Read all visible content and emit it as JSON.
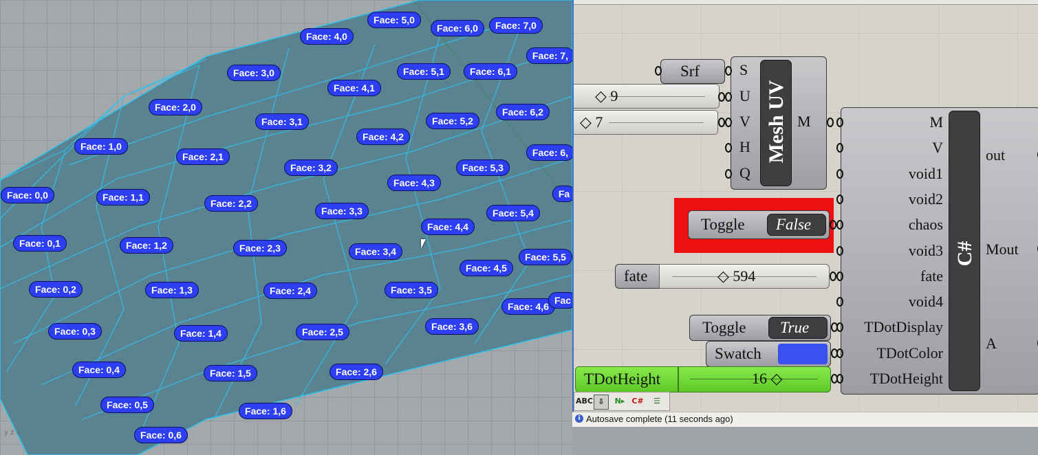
{
  "viewport": {
    "axes_label": "y z x",
    "face_labels": [
      "Face: 0,0",
      "Face: 0,1",
      "Face: 0,2",
      "Face: 0,3",
      "Face: 0,4",
      "Face: 0,5",
      "Face: 0,6",
      "Face: 1,0",
      "Face: 1,1",
      "Face: 1,2",
      "Face: 1,3",
      "Face: 1,4",
      "Face: 1,5",
      "Face: 1,6",
      "Face: 2,0",
      "Face: 2,1",
      "Face: 2,2",
      "Face: 2,3",
      "Face: 2,4",
      "Face: 2,5",
      "Face: 2,6",
      "Face: 3,0",
      "Face: 3,1",
      "Face: 3,2",
      "Face: 3,3",
      "Face: 3,4",
      "Face: 3,5",
      "Face: 3,6",
      "Face: 4,0",
      "Face: 4,1",
      "Face: 4,2",
      "Face: 4,3",
      "Face: 4,4",
      "Face: 4,5",
      "Face: 4,6",
      "Face: 5,0",
      "Face: 5,1",
      "Face: 5,2",
      "Face: 5,3",
      "Face: 5,4",
      "Face: 5,5",
      "Face: 6,0",
      "Face: 6,1",
      "Face: 6,2",
      "Face: 7,0",
      "Face: 7,",
      "Face: 6,",
      "Fa",
      "Fac"
    ]
  },
  "grasshopper": {
    "srf_label": "Srf",
    "meshuv": {
      "title": "Mesh UV",
      "inputs": [
        "S",
        "U",
        "V",
        "H",
        "Q"
      ],
      "output": "M"
    },
    "slider_u": {
      "value": "9"
    },
    "slider_v": {
      "value": "7"
    },
    "toggle_false": {
      "label": "Toggle",
      "value": "False"
    },
    "fate_slider": {
      "label": "fate",
      "value": "594"
    },
    "toggle_true": {
      "label": "Toggle",
      "value": "True"
    },
    "swatch": {
      "label": "Swatch",
      "color": "#3a50f0"
    },
    "tdotheight_slider": {
      "label": "TDotHeight",
      "value": "16"
    },
    "csharp": {
      "title": "C#",
      "inputs": [
        "M",
        "V",
        "void1",
        "void2",
        "chaos",
        "void3",
        "fate",
        "void4",
        "TDotDisplay",
        "TDotColor",
        "TDotHeight"
      ],
      "outputs": [
        "out",
        "Mout",
        "A"
      ]
    },
    "status": "Autosave complete (11 seconds ago)",
    "toolbar_icons": [
      "abc-icon",
      "download-icon",
      "node-icon",
      "csharp-icon",
      "align-icon"
    ]
  }
}
